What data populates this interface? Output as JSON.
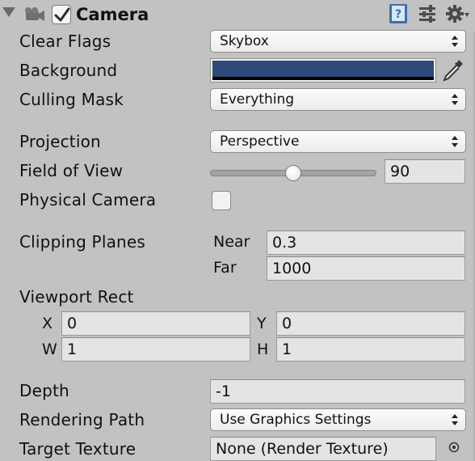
{
  "header": {
    "title": "Camera",
    "enabled": true,
    "icons": [
      "foldout-arrow-icon",
      "camera-icon",
      "help-book-icon",
      "presets-icon",
      "gear-icon"
    ]
  },
  "fields": {
    "clear_flags": {
      "label": "Clear Flags",
      "value": "Skybox"
    },
    "background": {
      "label": "Background",
      "color": "#2d4a78"
    },
    "culling_mask": {
      "label": "Culling Mask",
      "value": "Everything"
    },
    "projection": {
      "label": "Projection",
      "value": "Perspective"
    },
    "field_of_view": {
      "label": "Field of View",
      "value": "90",
      "slider_fraction": 0.5
    },
    "physical_camera": {
      "label": "Physical Camera",
      "checked": false
    },
    "clipping_planes": {
      "label": "Clipping Planes",
      "near_label": "Near",
      "near_value": "0.3",
      "far_label": "Far",
      "far_value": "1000"
    },
    "viewport_rect": {
      "label": "Viewport Rect",
      "x_label": "X",
      "x_value": "0",
      "y_label": "Y",
      "y_value": "0",
      "w_label": "W",
      "w_value": "1",
      "h_label": "H",
      "h_value": "1"
    },
    "depth": {
      "label": "Depth",
      "value": "-1"
    },
    "rendering_path": {
      "label": "Rendering Path",
      "value": "Use Graphics Settings"
    },
    "target_texture": {
      "label": "Target Texture",
      "value": "None (Render Texture)"
    }
  },
  "colors": {
    "panel_bg": "#c2c2c2",
    "field_bg": "#e4e4e4",
    "background_swatch": "#2d4a78"
  }
}
